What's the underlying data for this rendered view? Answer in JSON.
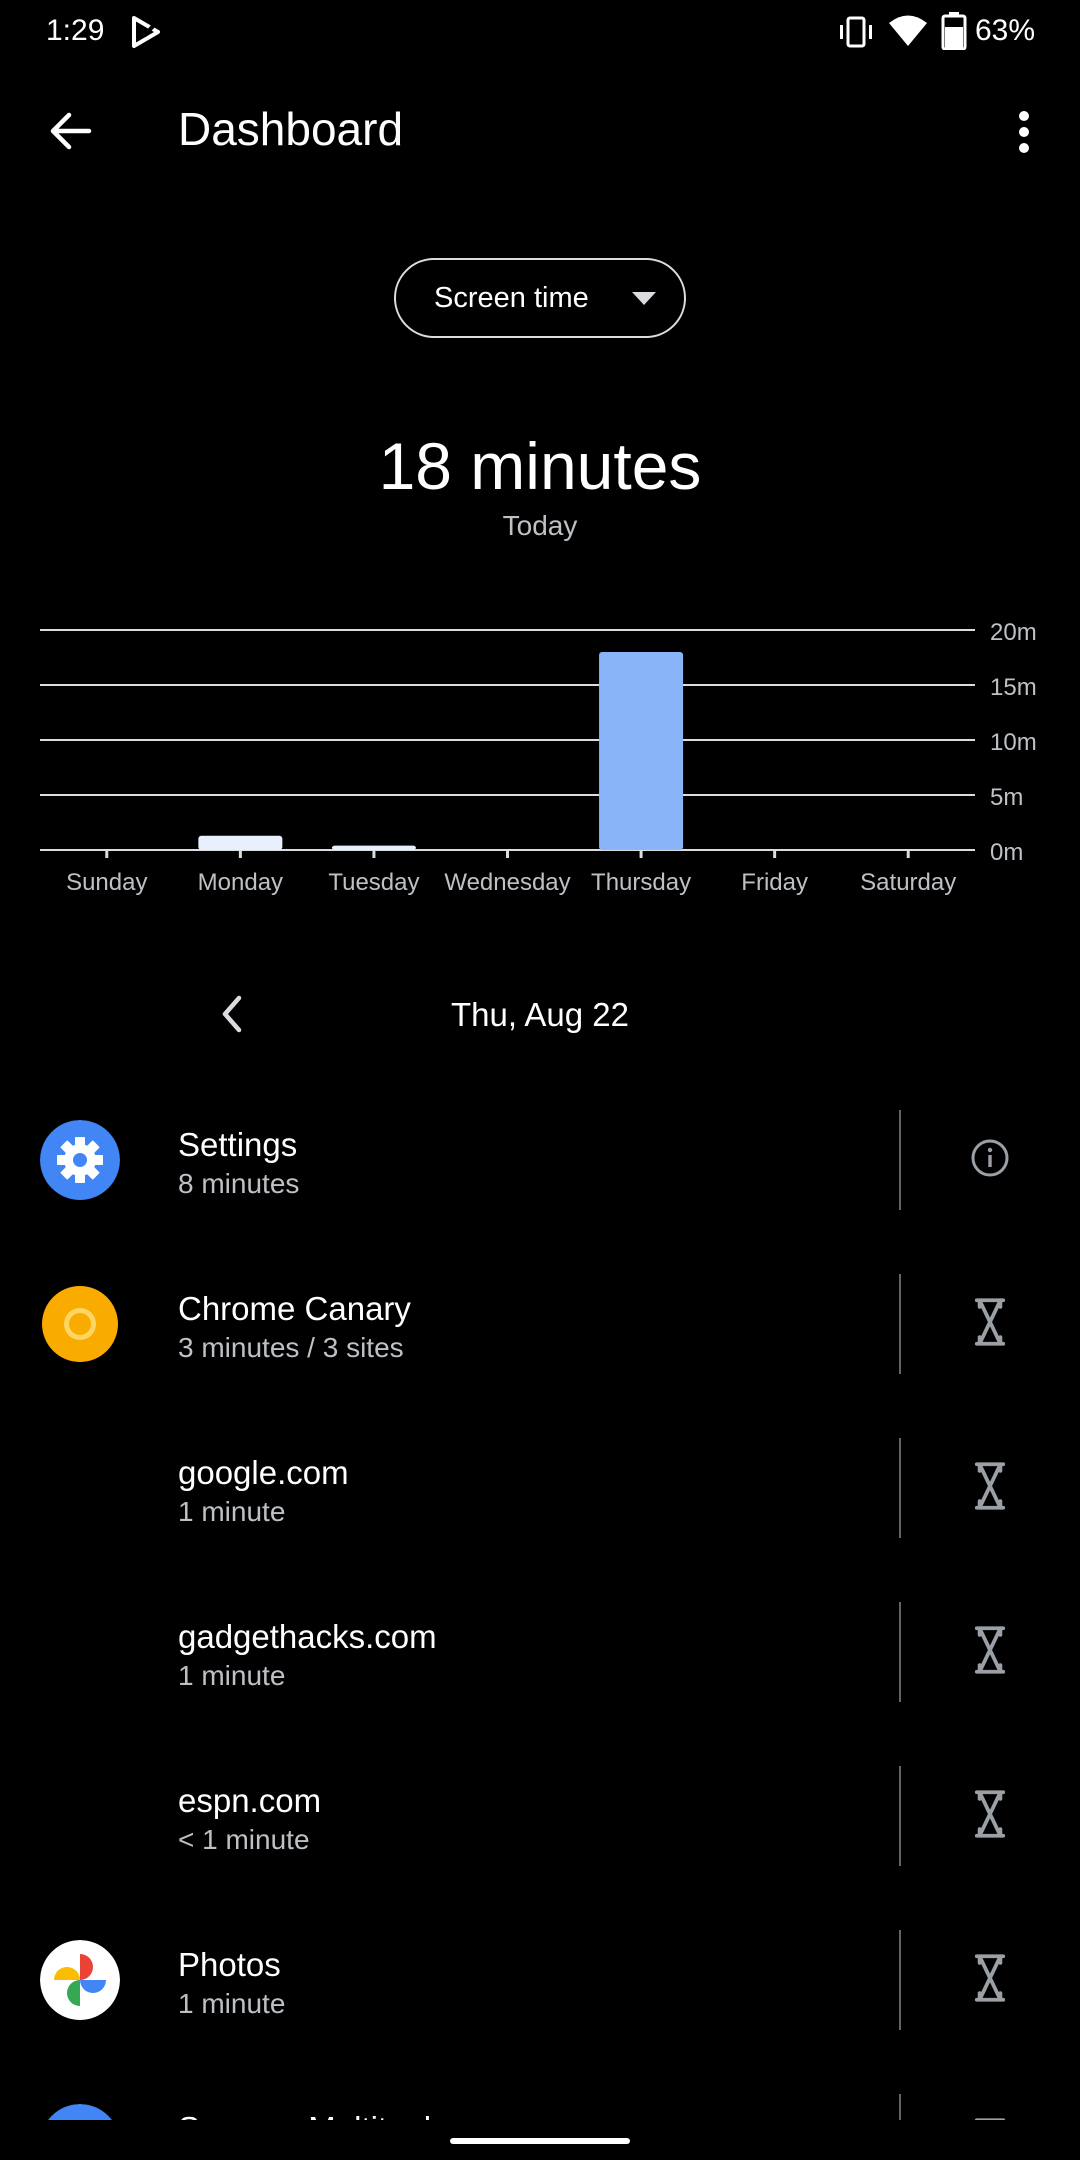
{
  "status": {
    "time": "1:29",
    "battery": "63%"
  },
  "app_bar": {
    "title": "Dashboard"
  },
  "metric_dropdown": {
    "selected": "Screen time"
  },
  "summary": {
    "total": "18 minutes",
    "period": "Today"
  },
  "chart_data": {
    "type": "bar",
    "categories": [
      "Sunday",
      "Monday",
      "Tuesday",
      "Wednesday",
      "Thursday",
      "Friday",
      "Saturday"
    ],
    "values": [
      0,
      1.3,
      0.4,
      0,
      18,
      0,
      0
    ],
    "y_ticks": [
      "0m",
      "5m",
      "10m",
      "15m",
      "20m"
    ],
    "ylim": [
      0,
      20
    ],
    "highlight_index": 4,
    "bar_color": "#8ab4f8",
    "bar_color_muted": "#e8f0fe",
    "grid": true
  },
  "date_nav": {
    "label": "Thu, Aug 22"
  },
  "apps": [
    {
      "name": "Settings",
      "detail": "8 minutes",
      "icon": "settings-gear-icon",
      "action": "info-icon"
    },
    {
      "name": "Chrome Canary",
      "detail": "3 minutes / 3 sites",
      "icon": "chrome-canary-icon",
      "action": "hourglass-icon"
    },
    {
      "name": "google.com",
      "detail": "1 minute",
      "icon": "",
      "action": "hourglass-icon"
    },
    {
      "name": "gadgethacks.com",
      "detail": "1 minute",
      "icon": "",
      "action": "hourglass-icon"
    },
    {
      "name": "espn.com",
      "detail": "< 1 minute",
      "icon": "",
      "action": "hourglass-icon"
    },
    {
      "name": "Photos",
      "detail": "1 minute",
      "icon": "photos-pinwheel-icon",
      "action": "hourglass-icon"
    },
    {
      "name": "Sensors Multitool",
      "detail": "",
      "icon": "sensors-multitool-icon",
      "action": "hourglass-icon"
    }
  ],
  "colors": {
    "background": "#000000",
    "accent": "#8ab4f8",
    "settings_blue": "#4285f4",
    "canary_yellow": "#f9ab00"
  }
}
